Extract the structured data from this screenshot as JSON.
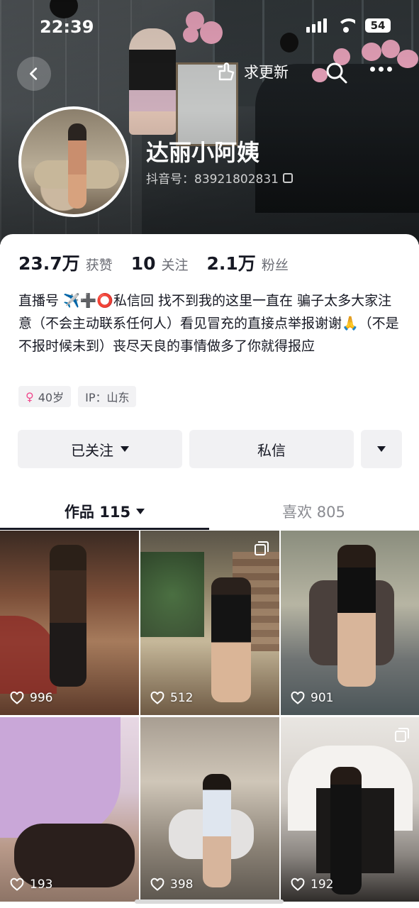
{
  "status_bar": {
    "time": "22:39",
    "battery": "54"
  },
  "header": {
    "update_label": "求更新",
    "nickname": "达丽小阿姨",
    "douyin_id": "抖音号：83921802831"
  },
  "stats": [
    {
      "value": "23.7万",
      "label": "获赞"
    },
    {
      "value": "10",
      "label": "关注"
    },
    {
      "value": "2.1万",
      "label": "粉丝"
    }
  ],
  "bio": "直播号 ✈️➕⭕私信回 找不到我的这里一直在 骗子太多大家注意（不会主动联系任何人）看见冒充的直接点举报谢谢🙏（不是不报时候未到）丧尽天良的事情做多了你就得报应",
  "tags": {
    "age": "40岁",
    "ip": "IP：山东"
  },
  "actions": {
    "follow": "已关注",
    "message": "私信"
  },
  "tabs": {
    "works": "作品 115",
    "likes": "喜欢 805"
  },
  "videos": [
    {
      "likes": "996"
    },
    {
      "likes": "512"
    },
    {
      "likes": "901"
    },
    {
      "likes": "193"
    },
    {
      "likes": "398"
    },
    {
      "likes": "192"
    }
  ],
  "colors": {
    "accent_pink": "#f0488c",
    "text_primary": "#161823",
    "button_bg": "#f1f1f3"
  }
}
